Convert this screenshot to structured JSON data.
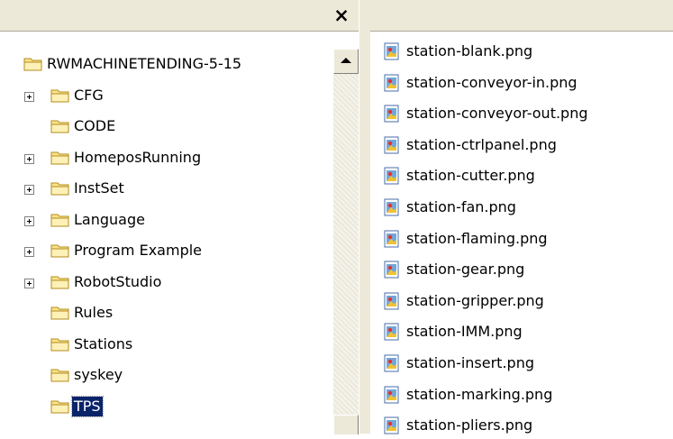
{
  "left_pane": {
    "close_symbol": "×",
    "tree": [
      {
        "label": "RWMACHINETENDING-5-15",
        "level": 0,
        "expandable": false,
        "selected": false
      },
      {
        "label": "CFG",
        "level": 1,
        "expandable": true,
        "selected": false
      },
      {
        "label": "CODE",
        "level": 1,
        "expandable": false,
        "selected": false
      },
      {
        "label": "HomeposRunning",
        "level": 1,
        "expandable": true,
        "selected": false
      },
      {
        "label": "InstSet",
        "level": 1,
        "expandable": true,
        "selected": false
      },
      {
        "label": "Language",
        "level": 1,
        "expandable": true,
        "selected": false
      },
      {
        "label": "Program Example",
        "level": 1,
        "expandable": true,
        "selected": false
      },
      {
        "label": "RobotStudio",
        "level": 1,
        "expandable": true,
        "selected": false
      },
      {
        "label": "Rules",
        "level": 1,
        "expandable": false,
        "selected": false
      },
      {
        "label": "Stations",
        "level": 1,
        "expandable": false,
        "selected": false
      },
      {
        "label": "syskey",
        "level": 1,
        "expandable": false,
        "selected": false
      },
      {
        "label": "TPS",
        "level": 1,
        "expandable": false,
        "selected": true
      }
    ]
  },
  "right_pane": {
    "files": [
      "station-blank.png",
      "station-conveyor-in.png",
      "station-conveyor-out.png",
      "station-ctrlpanel.png",
      "station-cutter.png",
      "station-fan.png",
      "station-flaming.png",
      "station-gear.png",
      "station-gripper.png",
      "station-IMM.png",
      "station-insert.png",
      "station-marking.png",
      "station-pliers.png"
    ]
  },
  "icons": {
    "folder": "folder-icon",
    "file": "png-image-icon",
    "expand": "plus-expander-icon",
    "close": "close-icon",
    "scroll_up": "arrow-up-icon"
  },
  "colors": {
    "chrome": "#ece9d8",
    "selection": "#0a246a",
    "folder_fill": "#f9e38c",
    "folder_stroke": "#b58c1b"
  }
}
